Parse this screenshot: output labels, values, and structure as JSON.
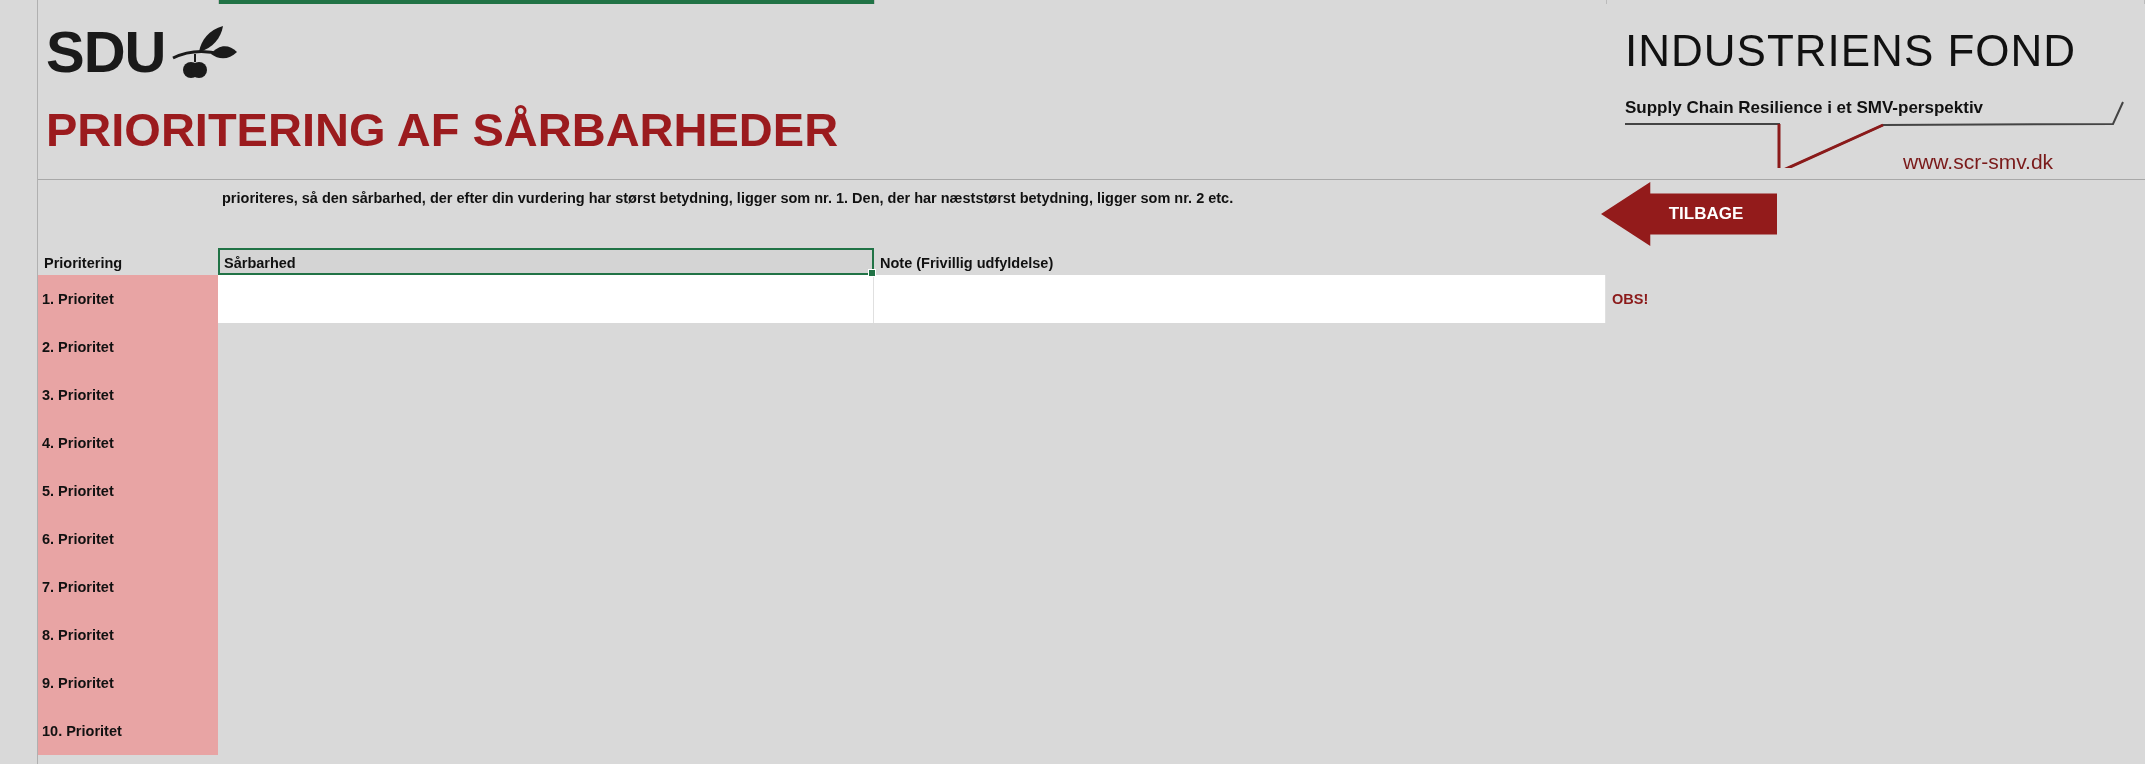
{
  "header": {
    "logo": "SDU",
    "title": "PRIORITERING AF SÅRBARHEDER",
    "partner_logo": "INDUSTRIENS FOND",
    "tagline": "Supply Chain Resilience i et SMV-perspektiv",
    "website": "www.scr-smv.dk"
  },
  "instructions": "prioriteres, så den sårbarhed, der efter din vurdering har størst betydning, ligger som nr. 1. Den, der har næststørst betydning, ligger som nr. 2 etc.",
  "back_button": "TILBAGE",
  "table": {
    "columns": [
      {
        "label": "Prioritering",
        "selected": false
      },
      {
        "label": "Sårbarhed",
        "selected": true
      },
      {
        "label": "Note (Frivillig udfyldelse)",
        "selected": false
      }
    ],
    "rows": [
      {
        "label": "1. Prioritet",
        "active": true,
        "note": "OBS!"
      },
      {
        "label": "2. Prioritet",
        "active": false
      },
      {
        "label": "3. Prioritet",
        "active": false
      },
      {
        "label": "4. Prioritet",
        "active": false
      },
      {
        "label": "5. Prioritet",
        "active": false
      },
      {
        "label": "6. Prioritet",
        "active": false
      },
      {
        "label": "7. Prioritet",
        "active": false
      },
      {
        "label": "8. Prioritet",
        "active": false
      },
      {
        "label": "9. Prioritet",
        "active": false
      },
      {
        "label": "10. Prioritet",
        "active": false
      }
    ]
  }
}
